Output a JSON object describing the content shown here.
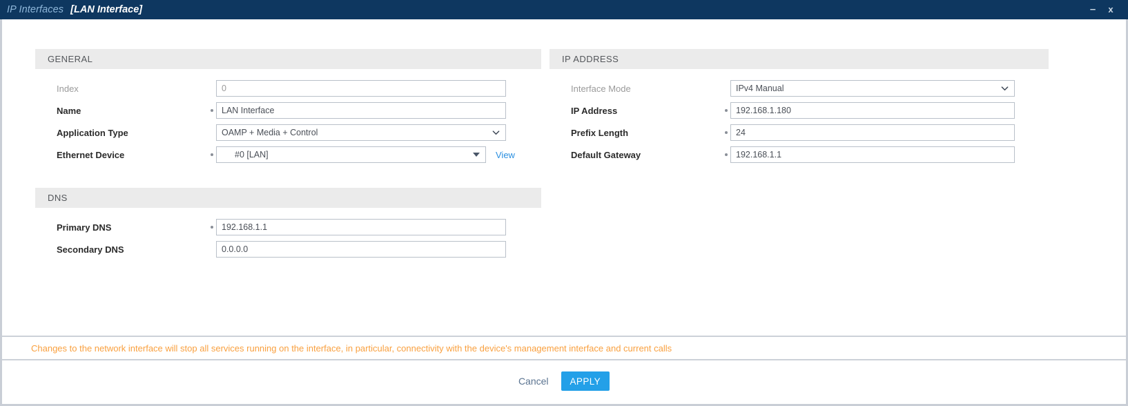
{
  "titlebar": {
    "title": "IP Interfaces",
    "subtitle": "[LAN Interface]",
    "minimize_icon": "minimize-icon",
    "minimize_glyph": "–",
    "close_icon": "close-icon",
    "close_glyph": "x"
  },
  "sections": {
    "general": {
      "header": "GENERAL",
      "fields": {
        "index": {
          "label": "Index",
          "value": "0",
          "required": false,
          "dim": true
        },
        "name": {
          "label": "Name",
          "value": "LAN Interface",
          "required": true,
          "dim": false
        },
        "application_type": {
          "label": "Application Type",
          "value": "OAMP + Media + Control",
          "required": false,
          "dim": false
        },
        "ethernet_device": {
          "label": "Ethernet Device",
          "value": "#0 [LAN]",
          "required": true,
          "dim": false,
          "view_link": "View"
        }
      }
    },
    "dns": {
      "header": "DNS",
      "fields": {
        "primary_dns": {
          "label": "Primary DNS",
          "value": "192.168.1.1",
          "required": true,
          "dim": false
        },
        "secondary_dns": {
          "label": "Secondary DNS",
          "value": "0.0.0.0",
          "required": false,
          "dim": false
        }
      }
    },
    "ip_address": {
      "header": "IP ADDRESS",
      "fields": {
        "interface_mode": {
          "label": "Interface Mode",
          "value": "IPv4 Manual",
          "required": false,
          "dim": true
        },
        "ip_address": {
          "label": "IP Address",
          "value": "192.168.1.180",
          "required": true,
          "dim": false
        },
        "prefix_length": {
          "label": "Prefix Length",
          "value": "24",
          "required": true,
          "dim": false
        },
        "default_gateway": {
          "label": "Default Gateway",
          "value": "192.168.1.1",
          "required": true,
          "dim": false
        }
      }
    }
  },
  "warning": {
    "text": "Changes to the network interface will stop all services running on the interface, in particular, connectivity with the device's management interface and current calls"
  },
  "footer": {
    "cancel_label": "Cancel",
    "apply_label": "APPLY"
  },
  "colors": {
    "titlebar_bg": "#0e3760",
    "accent_blue": "#1e90ff",
    "apply_blue": "#23a0e8",
    "link_blue": "#2a8fe0",
    "warning_orange": "#f9a03f",
    "section_header_bg": "#ebebeb"
  }
}
